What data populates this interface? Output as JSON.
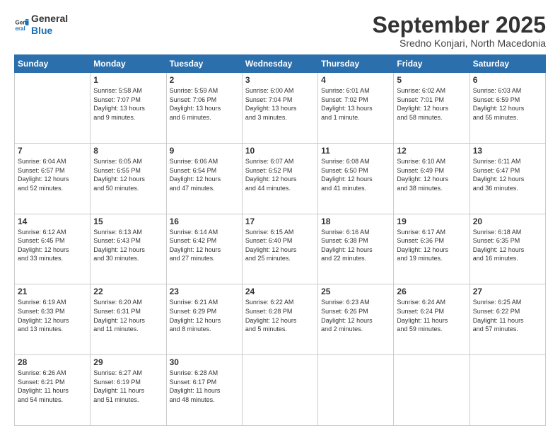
{
  "logo": {
    "general": "General",
    "blue": "Blue"
  },
  "header": {
    "month": "September 2025",
    "location": "Sredno Konjari, North Macedonia"
  },
  "weekdays": [
    "Sunday",
    "Monday",
    "Tuesday",
    "Wednesday",
    "Thursday",
    "Friday",
    "Saturday"
  ],
  "weeks": [
    [
      {
        "day": "",
        "info": ""
      },
      {
        "day": "1",
        "info": "Sunrise: 5:58 AM\nSunset: 7:07 PM\nDaylight: 13 hours\nand 9 minutes."
      },
      {
        "day": "2",
        "info": "Sunrise: 5:59 AM\nSunset: 7:06 PM\nDaylight: 13 hours\nand 6 minutes."
      },
      {
        "day": "3",
        "info": "Sunrise: 6:00 AM\nSunset: 7:04 PM\nDaylight: 13 hours\nand 3 minutes."
      },
      {
        "day": "4",
        "info": "Sunrise: 6:01 AM\nSunset: 7:02 PM\nDaylight: 13 hours\nand 1 minute."
      },
      {
        "day": "5",
        "info": "Sunrise: 6:02 AM\nSunset: 7:01 PM\nDaylight: 12 hours\nand 58 minutes."
      },
      {
        "day": "6",
        "info": "Sunrise: 6:03 AM\nSunset: 6:59 PM\nDaylight: 12 hours\nand 55 minutes."
      }
    ],
    [
      {
        "day": "7",
        "info": "Sunrise: 6:04 AM\nSunset: 6:57 PM\nDaylight: 12 hours\nand 52 minutes."
      },
      {
        "day": "8",
        "info": "Sunrise: 6:05 AM\nSunset: 6:55 PM\nDaylight: 12 hours\nand 50 minutes."
      },
      {
        "day": "9",
        "info": "Sunrise: 6:06 AM\nSunset: 6:54 PM\nDaylight: 12 hours\nand 47 minutes."
      },
      {
        "day": "10",
        "info": "Sunrise: 6:07 AM\nSunset: 6:52 PM\nDaylight: 12 hours\nand 44 minutes."
      },
      {
        "day": "11",
        "info": "Sunrise: 6:08 AM\nSunset: 6:50 PM\nDaylight: 12 hours\nand 41 minutes."
      },
      {
        "day": "12",
        "info": "Sunrise: 6:10 AM\nSunset: 6:49 PM\nDaylight: 12 hours\nand 38 minutes."
      },
      {
        "day": "13",
        "info": "Sunrise: 6:11 AM\nSunset: 6:47 PM\nDaylight: 12 hours\nand 36 minutes."
      }
    ],
    [
      {
        "day": "14",
        "info": "Sunrise: 6:12 AM\nSunset: 6:45 PM\nDaylight: 12 hours\nand 33 minutes."
      },
      {
        "day": "15",
        "info": "Sunrise: 6:13 AM\nSunset: 6:43 PM\nDaylight: 12 hours\nand 30 minutes."
      },
      {
        "day": "16",
        "info": "Sunrise: 6:14 AM\nSunset: 6:42 PM\nDaylight: 12 hours\nand 27 minutes."
      },
      {
        "day": "17",
        "info": "Sunrise: 6:15 AM\nSunset: 6:40 PM\nDaylight: 12 hours\nand 25 minutes."
      },
      {
        "day": "18",
        "info": "Sunrise: 6:16 AM\nSunset: 6:38 PM\nDaylight: 12 hours\nand 22 minutes."
      },
      {
        "day": "19",
        "info": "Sunrise: 6:17 AM\nSunset: 6:36 PM\nDaylight: 12 hours\nand 19 minutes."
      },
      {
        "day": "20",
        "info": "Sunrise: 6:18 AM\nSunset: 6:35 PM\nDaylight: 12 hours\nand 16 minutes."
      }
    ],
    [
      {
        "day": "21",
        "info": "Sunrise: 6:19 AM\nSunset: 6:33 PM\nDaylight: 12 hours\nand 13 minutes."
      },
      {
        "day": "22",
        "info": "Sunrise: 6:20 AM\nSunset: 6:31 PM\nDaylight: 12 hours\nand 11 minutes."
      },
      {
        "day": "23",
        "info": "Sunrise: 6:21 AM\nSunset: 6:29 PM\nDaylight: 12 hours\nand 8 minutes."
      },
      {
        "day": "24",
        "info": "Sunrise: 6:22 AM\nSunset: 6:28 PM\nDaylight: 12 hours\nand 5 minutes."
      },
      {
        "day": "25",
        "info": "Sunrise: 6:23 AM\nSunset: 6:26 PM\nDaylight: 12 hours\nand 2 minutes."
      },
      {
        "day": "26",
        "info": "Sunrise: 6:24 AM\nSunset: 6:24 PM\nDaylight: 11 hours\nand 59 minutes."
      },
      {
        "day": "27",
        "info": "Sunrise: 6:25 AM\nSunset: 6:22 PM\nDaylight: 11 hours\nand 57 minutes."
      }
    ],
    [
      {
        "day": "28",
        "info": "Sunrise: 6:26 AM\nSunset: 6:21 PM\nDaylight: 11 hours\nand 54 minutes."
      },
      {
        "day": "29",
        "info": "Sunrise: 6:27 AM\nSunset: 6:19 PM\nDaylight: 11 hours\nand 51 minutes."
      },
      {
        "day": "30",
        "info": "Sunrise: 6:28 AM\nSunset: 6:17 PM\nDaylight: 11 hours\nand 48 minutes."
      },
      {
        "day": "",
        "info": ""
      },
      {
        "day": "",
        "info": ""
      },
      {
        "day": "",
        "info": ""
      },
      {
        "day": "",
        "info": ""
      }
    ]
  ]
}
